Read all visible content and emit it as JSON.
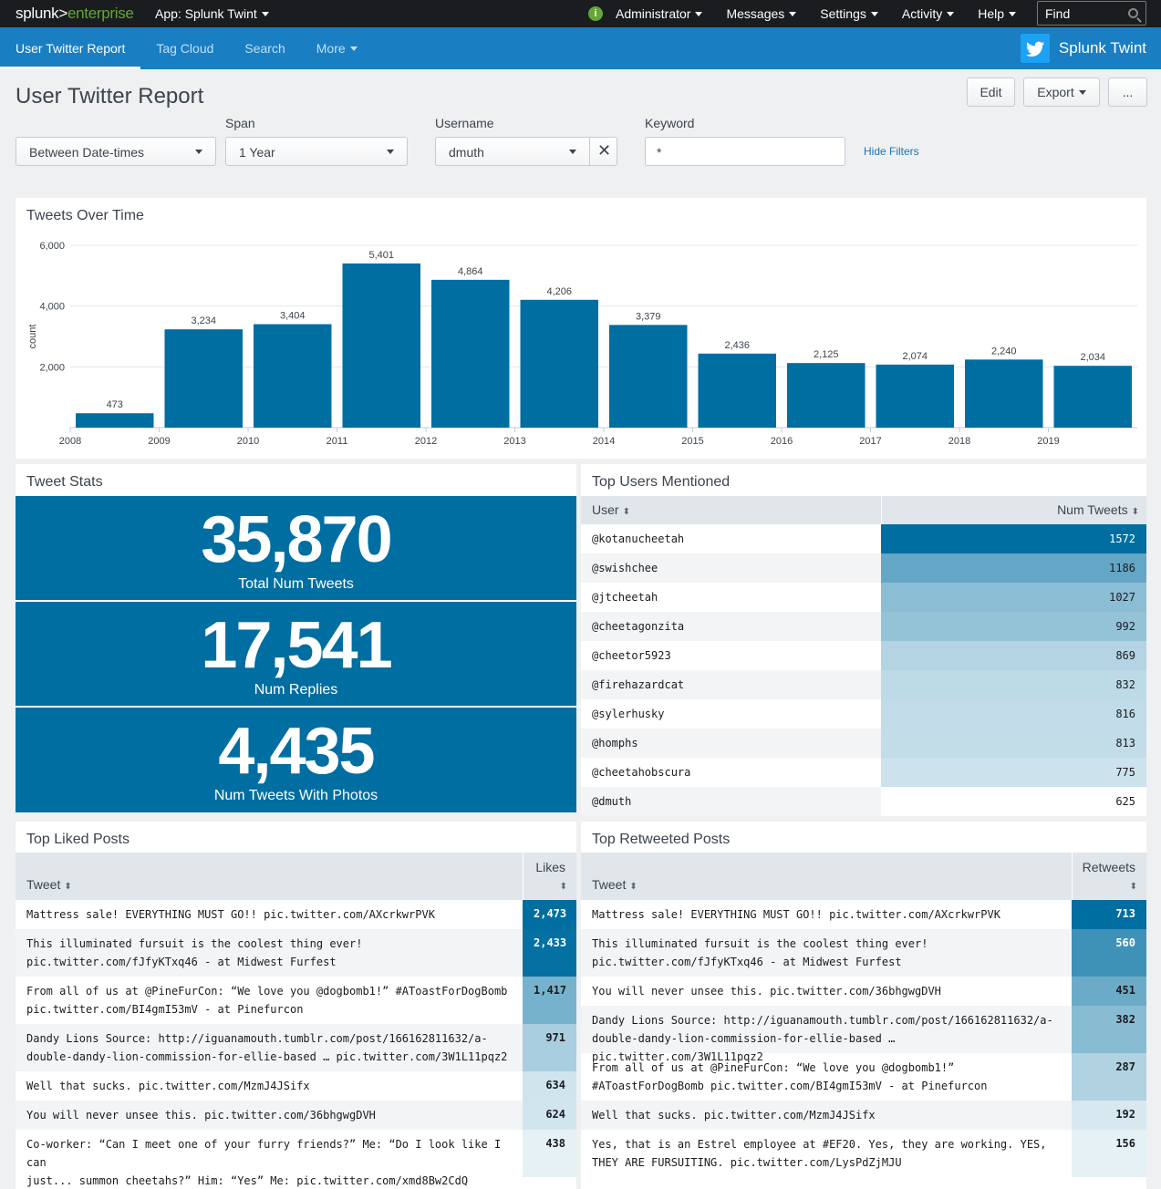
{
  "topbar": {
    "brand_w": "splunk>",
    "brand_g": "enterprise",
    "app": "App: Splunk Twint",
    "nav": [
      "Administrator",
      "Messages",
      "Settings",
      "Activity",
      "Help"
    ],
    "find": "Find"
  },
  "appbar": {
    "tabs": [
      "User Twitter Report",
      "Tag Cloud",
      "Search",
      "More"
    ],
    "app_title": "Splunk Twint"
  },
  "page": {
    "title": "User Twitter Report",
    "edit": "Edit",
    "export": "Export",
    "more": "..."
  },
  "filters": {
    "time": "Between Date-times",
    "span_label": "Span",
    "span": "1 Year",
    "username_label": "Username",
    "username": "dmuth",
    "keyword_label": "Keyword",
    "keyword": "*",
    "hide": "Hide Filters"
  },
  "chart_data": {
    "type": "bar",
    "title": "Tweets Over Time",
    "ylabel": "count",
    "ylim": [
      0,
      6000
    ],
    "yticks": [
      "6,000",
      "4,000",
      "2,000"
    ],
    "categories": [
      "2008",
      "2009",
      "2010",
      "2011",
      "2012",
      "2013",
      "2014",
      "2015",
      "2016",
      "2017",
      "2018",
      "2019"
    ],
    "values": [
      473,
      3234,
      3404,
      5401,
      4864,
      4206,
      3379,
      2436,
      2125,
      2074,
      2240,
      2034
    ],
    "labels": [
      "473",
      "3,234",
      "3,404",
      "5,401",
      "4,864",
      "4,206",
      "3,379",
      "2,436",
      "2,125",
      "2,074",
      "2,240",
      "2,034"
    ],
    "color": "#006ea0"
  },
  "stats": {
    "title": "Tweet Stats",
    "items": [
      {
        "num": "35,870",
        "label": "Total Num Tweets"
      },
      {
        "num": "17,541",
        "label": "Num Replies"
      },
      {
        "num": "4,435",
        "label": "Num Tweets With Photos"
      }
    ]
  },
  "mentions": {
    "title": "Top Users Mentioned",
    "col_user": "User",
    "col_num": "Num Tweets",
    "rows": [
      {
        "user": "@kotanucheetah",
        "n": "1572"
      },
      {
        "user": "@swishchee",
        "n": "1186"
      },
      {
        "user": "@jtcheetah",
        "n": "1027"
      },
      {
        "user": "@cheetagonzita",
        "n": "992"
      },
      {
        "user": "@cheetor5923",
        "n": "869"
      },
      {
        "user": "@firehazardcat",
        "n": "832"
      },
      {
        "user": "@sylerhusky",
        "n": "816"
      },
      {
        "user": "@homphs",
        "n": "813"
      },
      {
        "user": "@cheetahobscura",
        "n": "775"
      },
      {
        "user": "@dmuth",
        "n": "625"
      }
    ]
  },
  "liked": {
    "title": "Top Liked Posts",
    "col_tweet": "Tweet",
    "col_n": "Likes",
    "rows": [
      {
        "l1": "Mattress sale!  EVERYTHING MUST GO!! pic.twitter.com/AXcrkwrPVK",
        "l2": "",
        "n": "2,473"
      },
      {
        "l1": "This illuminated fursuit is the coolest thing ever!",
        "l2": "pic.twitter.com/fJfyKTxq46 - at Midwest Furfest",
        "n": "2,433"
      },
      {
        "l1": "From all of us at @PineFurCon: “We love you @dogbomb1!”   #AToastForDogBomb",
        "l2": "pic.twitter.com/BI4gmI53mV - at Pinefurcon",
        "n": "1,417"
      },
      {
        "l1": "Dandy Lions  Source:  http://iguanamouth.tumblr.com/post/166162811632/a-",
        "l2": "double-dandy-lion-commission-for-ellie-based … pic.twitter.com/3W1L11pqz2",
        "n": "971"
      },
      {
        "l1": "Well that sucks. pic.twitter.com/MzmJ4JSifx",
        "l2": "",
        "n": "634"
      },
      {
        "l1": "You will never unsee this. pic.twitter.com/36bhgwgDVH",
        "l2": "",
        "n": "624"
      },
      {
        "l1": "Co-worker: “Can I meet one of your furry friends?” Me: “Do I look like I can",
        "l2": "just... summon cheetahs?” Him: “Yes” Me: pic.twitter.com/xmd8Bw2CdQ",
        "n": "438"
      }
    ]
  },
  "retweeted": {
    "title": "Top Retweeted Posts",
    "col_tweet": "Tweet",
    "col_n": "Retweets",
    "rows": [
      {
        "l1": "Mattress sale!  EVERYTHING MUST GO!! pic.twitter.com/AXcrkwrPVK",
        "l2": "",
        "n": "713"
      },
      {
        "l1": "This illuminated fursuit is the coolest thing ever!",
        "l2": "pic.twitter.com/fJfyKTxq46 - at Midwest Furfest",
        "n": "560"
      },
      {
        "l1": "You will never unsee this. pic.twitter.com/36bhgwgDVH",
        "l2": "",
        "n": "451"
      },
      {
        "l1": "Dandy Lions  Source:  http://iguanamouth.tumblr.com/post/166162811632/a-",
        "l2": "double-dandy-lion-commission-for-ellie-based … pic.twitter.com/3W1L11pqz2",
        "n": "382"
      },
      {
        "l1": "From all of us at @PineFurCon: “We love you @dogbomb1!”",
        "l2": "#AToastForDogBomb pic.twitter.com/BI4gmI53mV - at Pinefurcon",
        "n": "287"
      },
      {
        "l1": "Well that sucks. pic.twitter.com/MzmJ4JSifx",
        "l2": "",
        "n": "192"
      },
      {
        "l1": "Yes, that is an Estrel employee at #EF20.  Yes, they are working. YES,",
        "l2": "THEY ARE FURSUITING. pic.twitter.com/LysPdZjMJU",
        "n": "156"
      }
    ]
  }
}
